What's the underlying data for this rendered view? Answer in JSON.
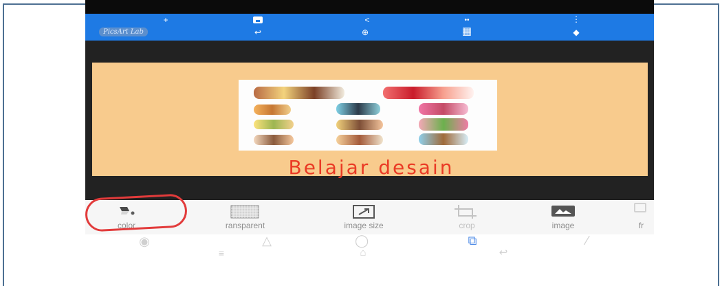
{
  "app": {
    "logo_text": "PicsArt Lab",
    "colors": {
      "toolbar": "#1e7ae4",
      "workspace": "#222222",
      "canvas": "#f8cb8d",
      "caption": "#ea3a25",
      "highlight": "#e23b3b"
    }
  },
  "toolbar": {
    "icons": [
      {
        "name": "add-icon",
        "glyph": "+"
      },
      {
        "name": "save-icon",
        "glyph": ""
      },
      {
        "name": "share-icon",
        "glyph": "<"
      },
      {
        "name": "quote-icon",
        "glyph": "••"
      },
      {
        "name": "more-icon",
        "glyph": "⋮"
      },
      {
        "name": "undo-icon",
        "glyph": "↩"
      },
      {
        "name": "zoom-icon",
        "glyph": "⊕"
      },
      {
        "name": "grid-icon",
        "glyph": "▦"
      },
      {
        "name": "layers-icon",
        "glyph": "◆"
      }
    ]
  },
  "canvas": {
    "caption": "Belajar desain"
  },
  "bottom_toolbar": {
    "tools": [
      {
        "label": "color",
        "icon": "paint-bucket-icon"
      },
      {
        "label": "ransparent",
        "icon": "transparency-grid-icon"
      },
      {
        "label": "image size",
        "icon": "resize-icon"
      },
      {
        "label": "crop",
        "icon": "crop-icon"
      },
      {
        "label": "image",
        "icon": "image-icon"
      },
      {
        "label": "fr",
        "icon": "frame-icon"
      }
    ]
  },
  "navigation": {
    "icons": [
      "camera-icon",
      "triangle-icon",
      "circle-icon",
      "copy-icon",
      "wand-icon",
      "menu-icon",
      "home-icon",
      "back-icon"
    ]
  }
}
